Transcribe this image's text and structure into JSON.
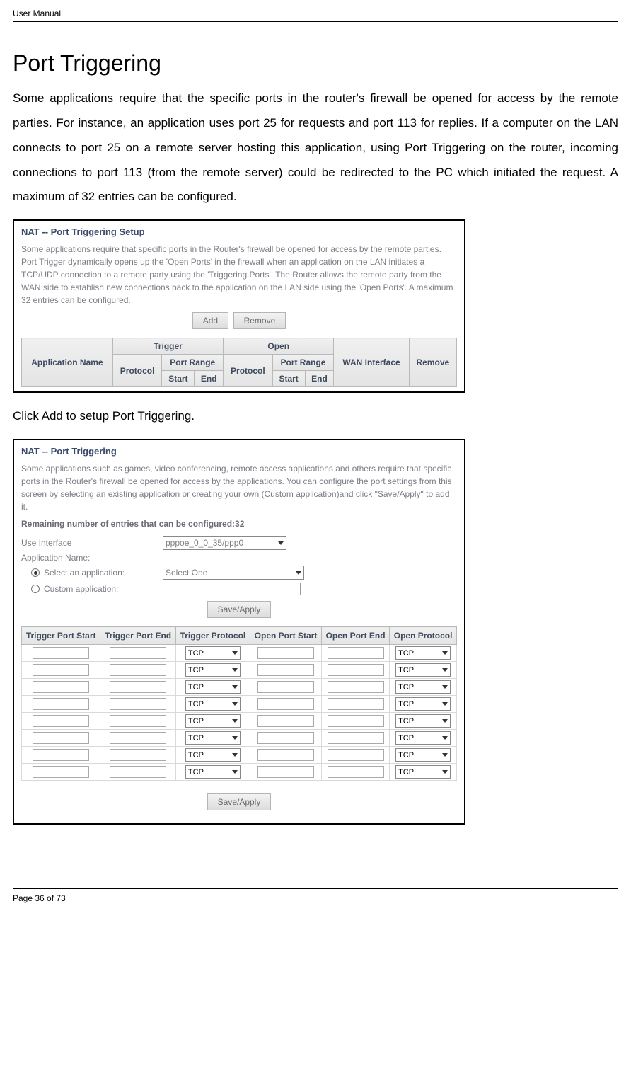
{
  "doc_header": "User Manual",
  "title": "Port Triggering",
  "body1": "Some applications require that the specific ports in the router's firewall be opened for access by the remote parties. For instance, an application uses port 25 for requests and port 113 for replies. If a computer on the LAN connects to port 25 on a remote server hosting this application, using Port Triggering on the router, incoming connections to port 113 (from the remote server) could be redirected to the PC which initiated the request. A maximum of 32 entries can be configured.",
  "body2": "Click Add to setup Port Triggering.",
  "ss1": {
    "title": "NAT -- Port Triggering Setup",
    "desc": "Some applications require that specific ports in the Router's firewall be opened for access by the remote parties. Port Trigger dynamically opens up the 'Open Ports' in the firewall when an application on the LAN initiates a TCP/UDP connection to a remote party using the 'Triggering Ports'. The Router allows the remote party from the WAN side to establish new connections back to the application on the LAN side using the 'Open Ports'. A maximum 32 entries can be configured.",
    "buttons": {
      "add": "Add",
      "remove": "Remove"
    },
    "table": {
      "app_name": "Application Name",
      "trigger": "Trigger",
      "open": "Open",
      "wan": "WAN Interface",
      "remove": "Remove",
      "protocol": "Protocol",
      "port_range": "Port Range",
      "start": "Start",
      "end": "End"
    }
  },
  "ss2": {
    "title": "NAT -- Port Triggering",
    "desc": "Some applications such as games, video conferencing, remote access applications and others require that specific ports in the Router's firewall be opened for access by the applications. You can configure the port settings from this screen by selecting an existing application or creating your own (Custom application)and click \"Save/Apply\" to add it.",
    "remaining_label": "Remaining number of entries that can be configured:32",
    "use_interface_label": "Use Interface",
    "use_interface_value": "pppoe_0_0_35/ppp0",
    "app_name_label": "Application Name:",
    "select_app_label": "Select an application:",
    "select_app_value": "Select One",
    "custom_app_label": "Custom application:",
    "save_apply": "Save/Apply",
    "table_headers": {
      "tps": "Trigger Port Start",
      "tpe": "Trigger Port End",
      "tp": "Trigger Protocol",
      "ops": "Open Port Start",
      "ope": "Open Port End",
      "op": "Open Protocol"
    },
    "default_protocol": "TCP",
    "row_count": 8
  },
  "footer": "Page 36 of 73"
}
